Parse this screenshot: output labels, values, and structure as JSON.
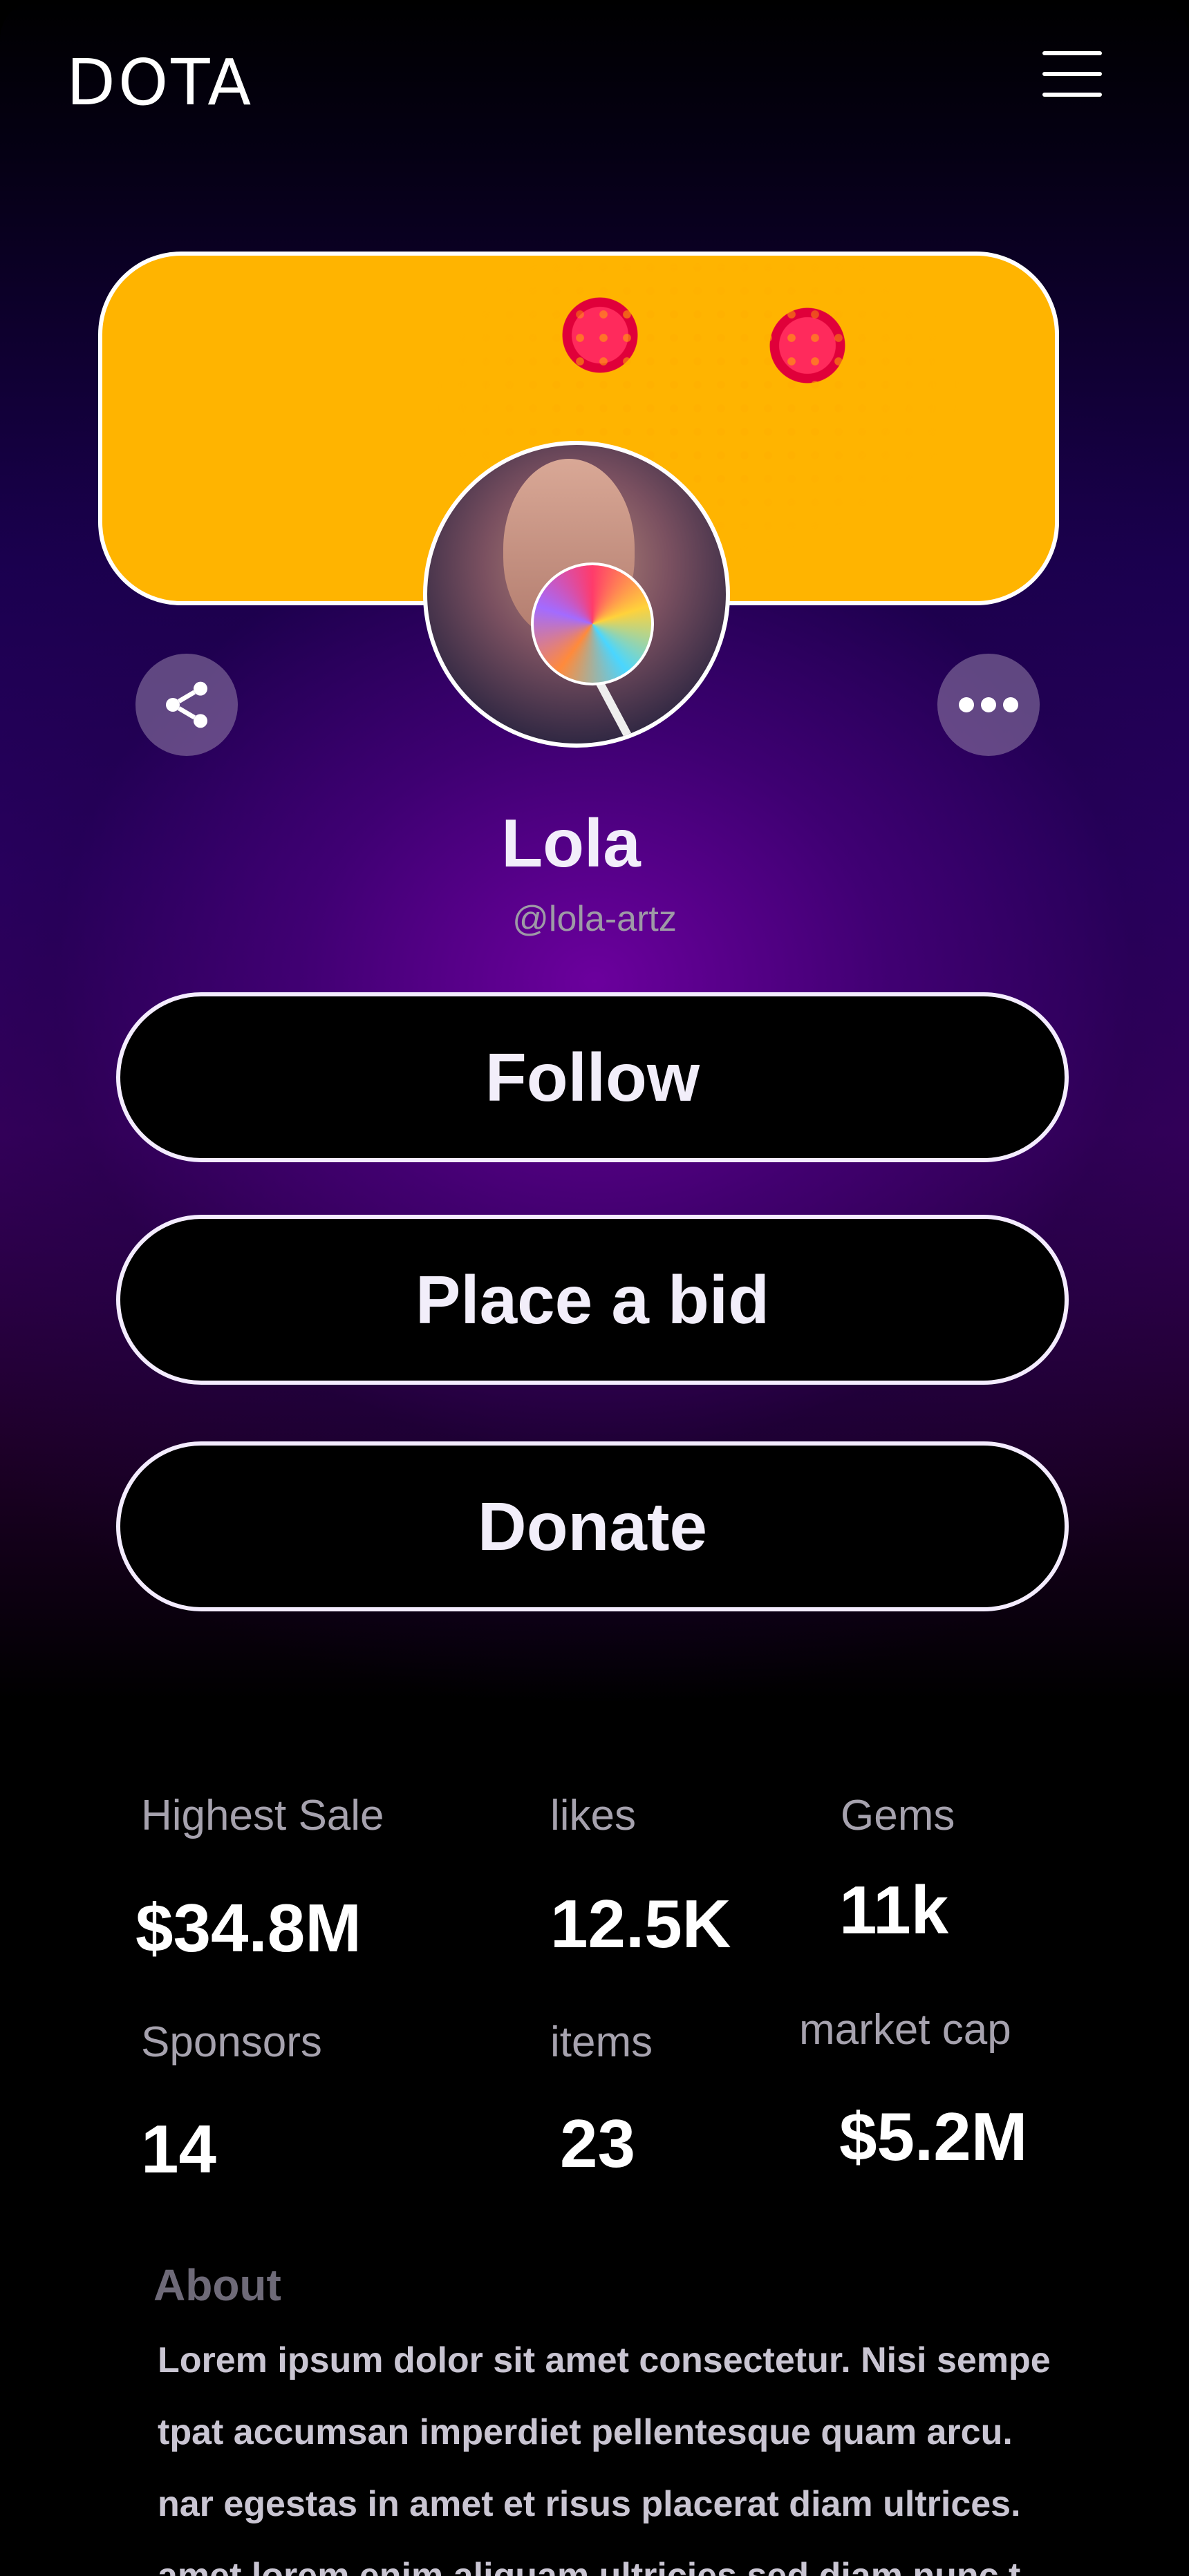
{
  "header": {
    "logo": "DOTA"
  },
  "profile": {
    "name": "Lola",
    "handle": "@lola-artz"
  },
  "icons": {
    "menu": "menu-icon",
    "share": "share-icon",
    "more": "more-horizontal-icon"
  },
  "actions": {
    "follow": "Follow",
    "bid": "Place a bid",
    "donate": "Donate"
  },
  "stats": [
    {
      "label": "Highest Sale",
      "value": "$34.8M"
    },
    {
      "label": "likes",
      "value": "12.5K"
    },
    {
      "label": "Gems",
      "value": "11k"
    },
    {
      "label": "Sponsors",
      "value": "14"
    },
    {
      "label": "items",
      "value": "23"
    },
    {
      "label": "market cap",
      "value": "$5.2M"
    }
  ],
  "about": {
    "title": "About",
    "lines": [
      "Lorem ipsum dolor sit amet consectetur. Nisi sempe",
      "tpat accumsan imperdiet pellentesque quam arcu.",
      "nar egestas in amet et risus placerat diam ultrices.",
      "amet lorem enim aliquam ultricies sed diam nunc t"
    ]
  },
  "colors": {
    "accent_purple": "#4a0080",
    "button_border": "#f4ecff",
    "muted_text": "#9e9aa6"
  }
}
